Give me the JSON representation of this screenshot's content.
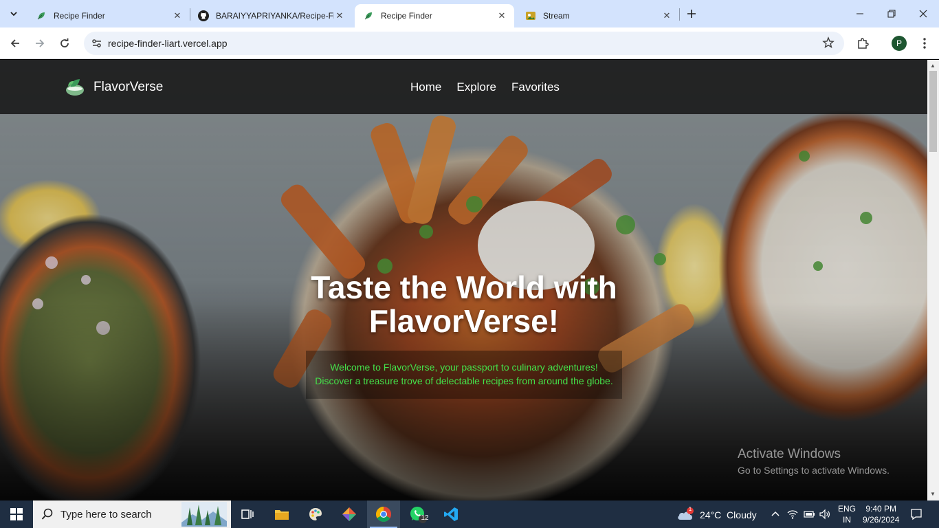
{
  "browser": {
    "tabs": [
      {
        "title": "Recipe Finder",
        "active": false
      },
      {
        "title": "BARAIYYAPRIYANKA/Recipe-Fin",
        "active": false
      },
      {
        "title": "Recipe Finder",
        "active": true
      },
      {
        "title": "Stream",
        "active": false
      }
    ],
    "url": "recipe-finder-liart.vercel.app",
    "profile_initial": "P"
  },
  "site": {
    "brand": "FlavorVerse",
    "nav": [
      "Home",
      "Explore",
      "Favorites"
    ],
    "hero_title_line1": "Taste the World with",
    "hero_title_line2": "FlavorVerse!",
    "hero_sub_line1": "Welcome to FlavorVerse, your passport to culinary adventures!",
    "hero_sub_line2": "Discover a treasure trove of delectable recipes from around the globe.",
    "accent_color": "#44e04a"
  },
  "watermark": {
    "line1": "Activate Windows",
    "line2": "Go to Settings to activate Windows."
  },
  "taskbar": {
    "search_placeholder": "Type here to search",
    "whatsapp_badge": "12",
    "weather_alert": "1",
    "weather": "24°C  Cloudy",
    "lang_line1": "ENG",
    "lang_line2": "IN",
    "time": "9:40 PM",
    "date": "9/26/2024"
  }
}
